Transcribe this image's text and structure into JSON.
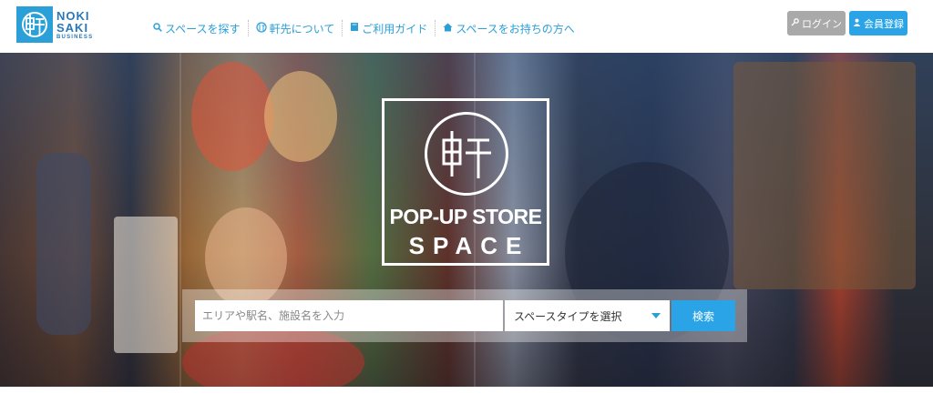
{
  "brand": {
    "line1": "NOKI",
    "line2": "SAKI",
    "line3": "BUSINESS",
    "color": "#2a9fd8"
  },
  "nav": {
    "items": [
      {
        "label": "スペースを探す",
        "icon": "search-icon"
      },
      {
        "label": "軒先について",
        "icon": "nokisaki-logo-icon"
      },
      {
        "label": "ご利用ガイド",
        "icon": "book-icon"
      },
      {
        "label": "スペースをお持ちの方へ",
        "icon": "home-icon"
      }
    ]
  },
  "auth": {
    "login_label": "ログイン",
    "register_label": "会員登録"
  },
  "hero": {
    "title_line1": "POP-UP STORE",
    "title_line2": "SPACE"
  },
  "search": {
    "placeholder": "エリアや駅名、施設名を入力",
    "type_selected": "スペースタイプを選択",
    "button_label": "検索",
    "accent": "#2aa4e6"
  }
}
